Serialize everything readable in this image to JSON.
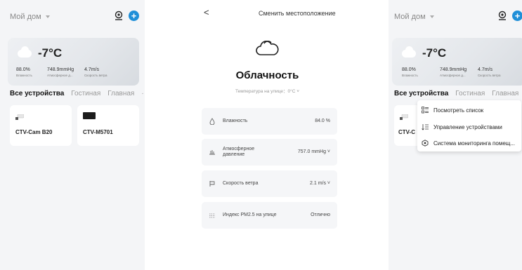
{
  "left": {
    "home_title": "Мой дом",
    "weather": {
      "temperature": "-7°C",
      "humidity_value": "88.0%",
      "humidity_label": "Влажность",
      "pressure_value": "748.9mmHg",
      "pressure_label": "Атмосферное д...",
      "wind_value": "4.7m/s",
      "wind_label": "Скорость ветра"
    },
    "tabs": [
      "Все устройства",
      "Гостиная",
      "Главная"
    ],
    "more": "···",
    "devices": [
      "CTV-Cam B20",
      "CTV-M5701"
    ]
  },
  "middle": {
    "back": "<",
    "title": "Сменить местоположение",
    "condition": "Облачность",
    "outdoor_temp": "Температура на улице：0°C ˅",
    "rows": [
      {
        "label": "Влажность",
        "value": "84.0 %"
      },
      {
        "label": "Атмосферное давление",
        "value": "757.0 mmHg ˅"
      },
      {
        "label": "Скорость ветра",
        "value": "2.1 m/s ˅"
      },
      {
        "label": "Индекс PM2.5 на улице",
        "value": "Отлично"
      }
    ]
  },
  "right": {
    "home_title": "Мой дом",
    "weather": {
      "temperature": "-7°C",
      "humidity_value": "88.0%",
      "humidity_label": "Влажность",
      "pressure_value": "748.9mmHg",
      "pressure_label": "Атмосферное д...",
      "wind_value": "4.7m/s",
      "wind_label": "Скорость ветра"
    },
    "tabs": [
      "Все устройства",
      "Гостиная",
      "Главная"
    ],
    "more": "···",
    "device_partial": "CTV-C",
    "menu": [
      "Посмотреть список",
      "Управление устройствами",
      "Система мониторинга помещ..."
    ]
  },
  "colors": {
    "accent": "#1f8fd8"
  },
  "icons": [
    "camera-icon",
    "add-icon",
    "cloud-icon",
    "water-drop-icon",
    "pressure-icon",
    "wind-icon",
    "pm25-icon",
    "list-icon",
    "sort-icon",
    "monitor-icon"
  ]
}
